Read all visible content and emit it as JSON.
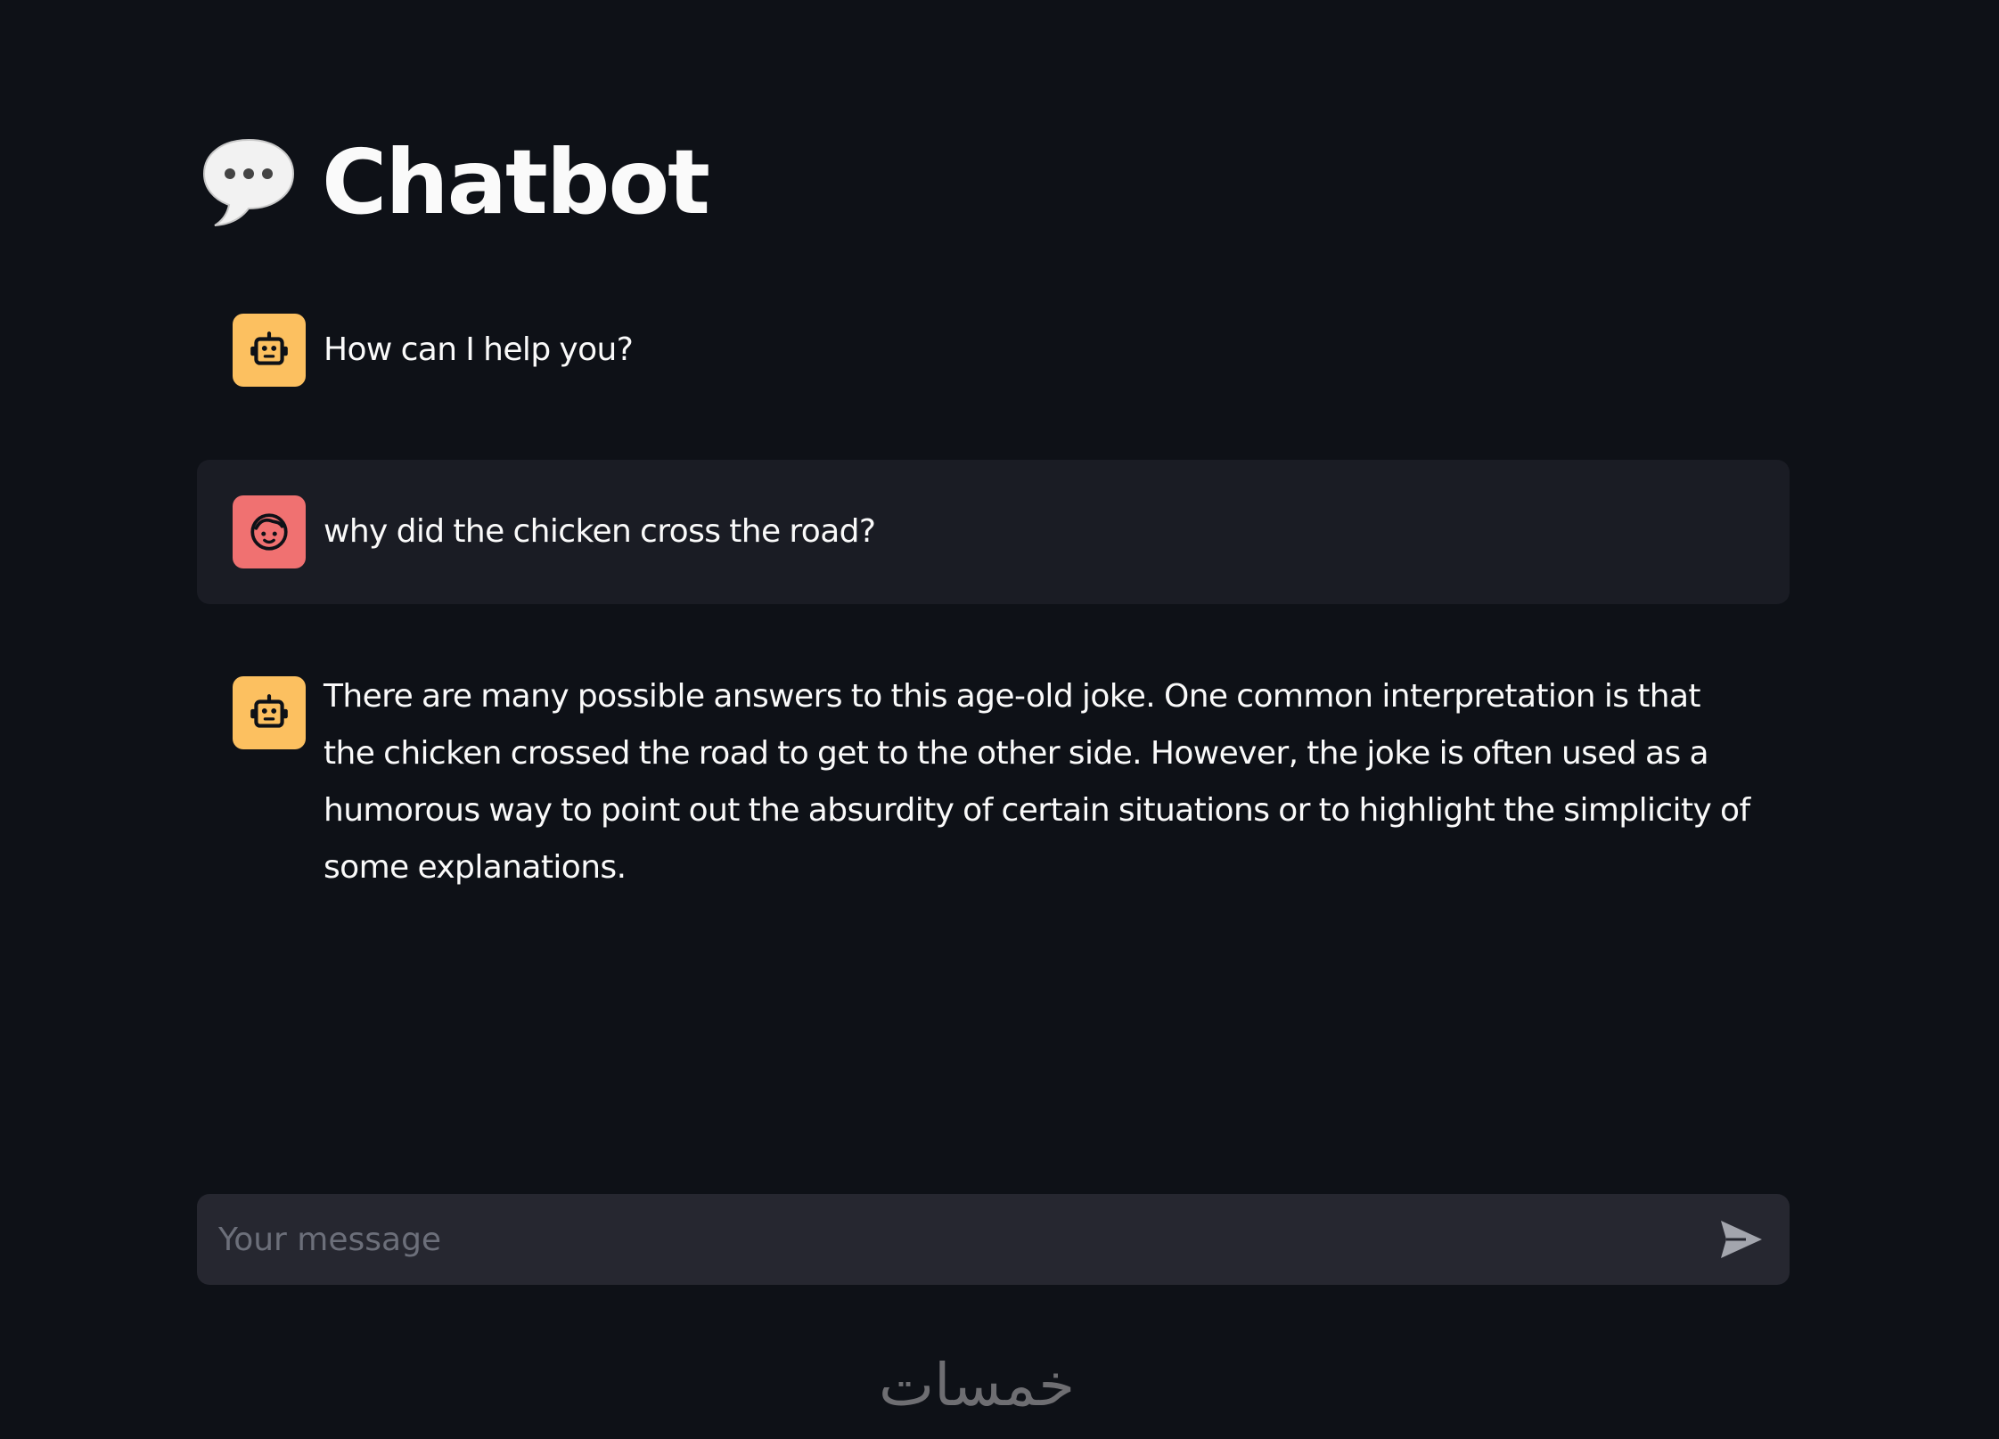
{
  "page": {
    "title": "Chatbot",
    "title_icon": "speech-bubble-icon"
  },
  "messages": [
    {
      "role": "assistant",
      "avatar_icon": "robot-icon",
      "text": "How can I help you?"
    },
    {
      "role": "user",
      "avatar_icon": "user-face-icon",
      "text": "why did the chicken cross the road?"
    },
    {
      "role": "assistant",
      "avatar_icon": "robot-icon",
      "text": "There are many possible answers to this age-old joke. One common interpretation is that the chicken crossed the road to get to the other side. However, the joke is often used as a humorous way to point out the absurdity of certain situations or to highlight the simplicity of some explanations."
    }
  ],
  "chat_input": {
    "placeholder": "Your message",
    "value": "",
    "send_icon": "send-icon"
  },
  "watermark": {
    "text": "خمسات"
  },
  "colors": {
    "background": "#0e1117",
    "user_message_bg": "#1a1c24",
    "input_bg": "#262730",
    "assistant_avatar": "#fcc060",
    "user_avatar": "#f07171",
    "text": "#fafafa",
    "placeholder": "#6c6f7a"
  }
}
